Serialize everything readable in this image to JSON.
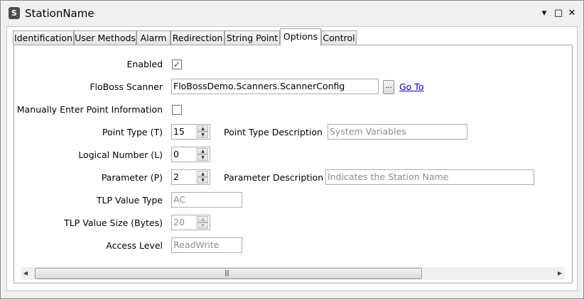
{
  "window": {
    "icon_letter": "S",
    "title": "StationName",
    "controls": {
      "menu": "▾",
      "maximize": "□",
      "close": "✕"
    }
  },
  "tabs": [
    {
      "label": "Identification",
      "active": false
    },
    {
      "label": "User Methods",
      "active": false
    },
    {
      "label": "Alarm",
      "active": false
    },
    {
      "label": "Redirection",
      "active": false
    },
    {
      "label": "String Point",
      "active": false
    },
    {
      "label": "Options",
      "active": true
    },
    {
      "label": "Control",
      "active": false
    }
  ],
  "form": {
    "enabled": {
      "label": "Enabled",
      "checked": true
    },
    "floboss_scanner": {
      "label": "FloBoss Scanner",
      "value": "FloBossDemo.Scanners.ScannerConfig",
      "browse_label": "...",
      "goto_label": "Go To"
    },
    "manual_entry": {
      "label": "Manually Enter Point Information",
      "checked": false
    },
    "point_type": {
      "label": "Point Type (T)",
      "value": "15",
      "desc_label": "Point Type Description",
      "desc_value": "System Variables"
    },
    "logical_number": {
      "label": "Logical Number (L)",
      "value": "0"
    },
    "parameter": {
      "label": "Parameter (P)",
      "value": "2",
      "desc_label": "Parameter Description",
      "desc_value": "Indicates the Station Name"
    },
    "tlp_value_type": {
      "label": "TLP Value Type",
      "value": "AC"
    },
    "tlp_value_size": {
      "label": "TLP Value Size (Bytes)",
      "value": "20"
    },
    "access_level": {
      "label": "Access Level",
      "value": "ReadWrite"
    }
  },
  "scrollbar": {
    "left_arrow": "◀",
    "right_arrow": "▶",
    "grip": "|||"
  },
  "colors": {
    "link": "#0000cc",
    "check": "#1b3d8f",
    "readonly_text": "#8c8c8c"
  }
}
